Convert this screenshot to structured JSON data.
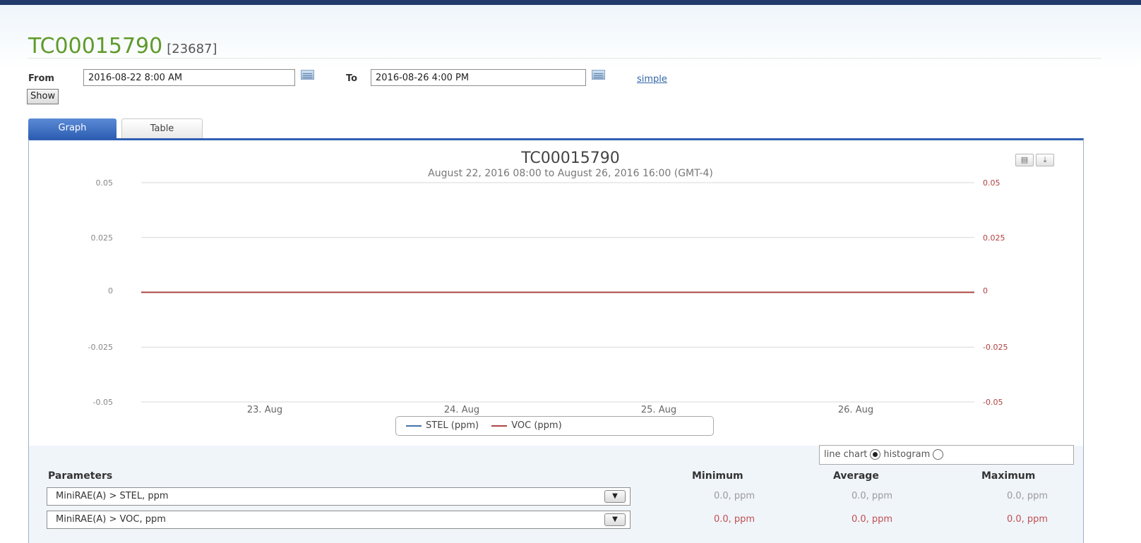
{
  "header": {
    "title": "TC00015790",
    "id": "[23687]"
  },
  "range": {
    "from_label": "From",
    "from_value": "2016-08-22 8:00 AM",
    "to_label": "To",
    "to_value": "2016-08-26 4:00 PM",
    "simple_link": "simple",
    "show_button": "Show"
  },
  "tabs": [
    {
      "label": "Graph",
      "active": true
    },
    {
      "label": "Table",
      "active": false
    }
  ],
  "chart": {
    "title": "TC00015790",
    "subtitle": "August 22, 2016 08:00 to August 26, 2016 16:00 (GMT-4)",
    "toolbar": [
      {
        "icon": "print-icon"
      },
      {
        "icon": "download-icon"
      }
    ],
    "legend": [
      {
        "name": "STEL (ppm)",
        "color": "#4572a7"
      },
      {
        "name": "VOC (ppm)",
        "color": "#aa4643"
      }
    ],
    "chart_type_label": "line chart",
    "histogram_label": "histogram",
    "selected_type": "line chart"
  },
  "chart_data": {
    "type": "line",
    "title": "TC00015790",
    "subtitle": "August 22, 2016 08:00 to August 26, 2016 16:00 (GMT-4)",
    "x_ticks": [
      "23. Aug",
      "24. Aug",
      "25. Aug",
      "26. Aug"
    ],
    "x_range": [
      "2016-08-22 08:00",
      "2016-08-26 16:00"
    ],
    "y_ticks": [
      "0.05",
      "0.025",
      "0",
      "-0.025",
      "-0.05"
    ],
    "y2_ticks": [
      "0.05",
      "0.025",
      "0",
      "-0.025",
      "-0.05"
    ],
    "ylim": [
      -0.05,
      0.05
    ],
    "grid": true,
    "legend_position": "bottom",
    "series": [
      {
        "name": "STEL (ppm)",
        "color": "#4572a7",
        "x": [
          "2016-08-22 08:00",
          "2016-08-26 16:00"
        ],
        "values": [
          0,
          0
        ]
      },
      {
        "name": "VOC (ppm)",
        "color": "#aa4643",
        "x": [
          "2016-08-22 08:00",
          "2016-08-26 16:00"
        ],
        "values": [
          0,
          0
        ]
      }
    ]
  },
  "stats": {
    "headers": {
      "parameters": "Parameters",
      "minimum": "Minimum",
      "average": "Average",
      "maximum": "Maximum"
    },
    "rows": [
      {
        "parameter": "MiniRAE(A) > STEL, ppm",
        "minimum": "0.0, ppm",
        "average": "0.0, ppm",
        "maximum": "0.0, ppm"
      },
      {
        "parameter": "MiniRAE(A) > VOC, ppm",
        "minimum": "0.0, ppm",
        "average": "0.0, ppm",
        "maximum": "0.0, ppm"
      }
    ]
  }
}
